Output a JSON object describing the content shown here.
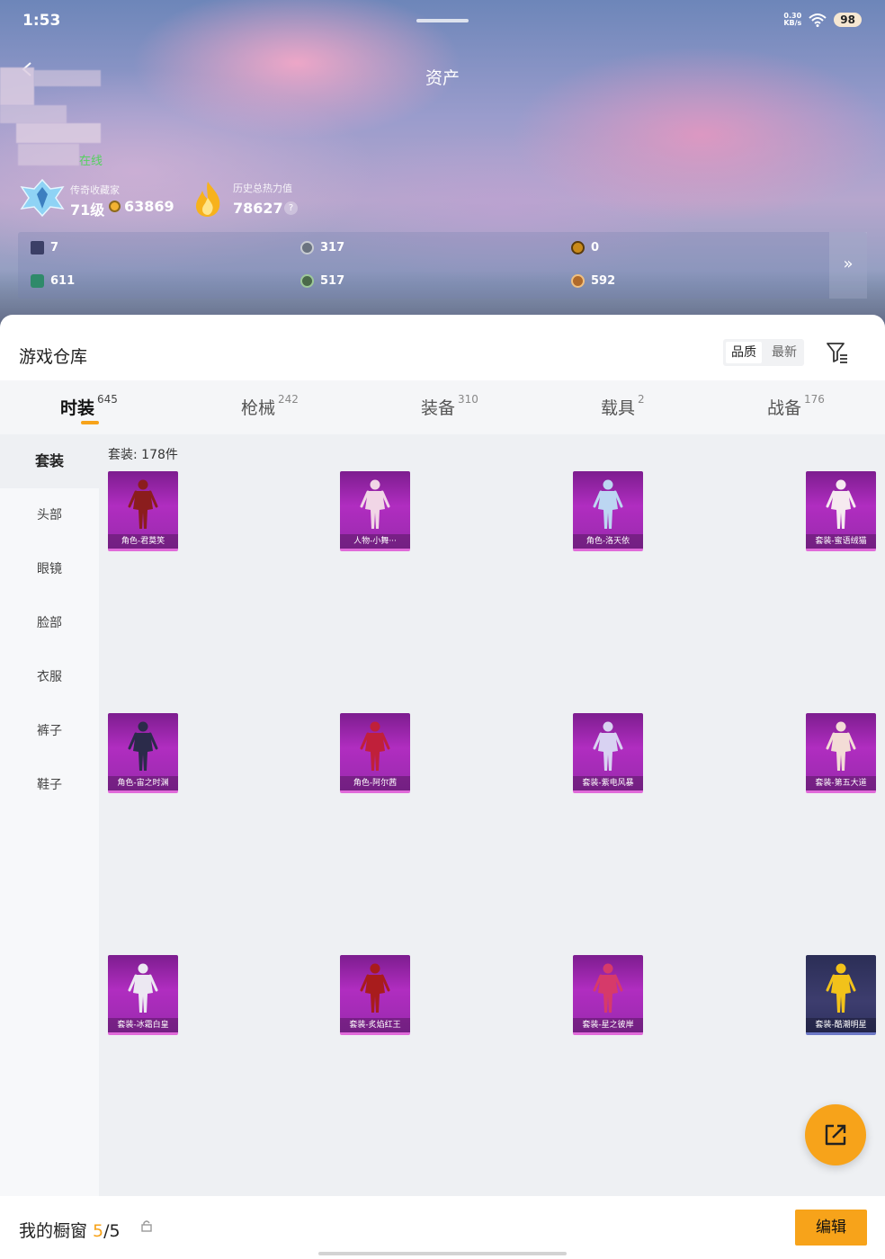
{
  "status": {
    "time": "1:53",
    "net_speed_top": "0.30",
    "net_speed_bottom": "KB/s",
    "battery": "98"
  },
  "header": {
    "title": "资产",
    "online": "在线",
    "rank_title": "传奇收藏家",
    "rank_level": "71级",
    "coins": "63869",
    "heat_title": "历史总热力值",
    "heat_value": "78627",
    "help": "?"
  },
  "stats": [
    {
      "icon": "card-icon",
      "value": "7",
      "color": "#3b3f66"
    },
    {
      "icon": "silver-coin-icon",
      "value": "317",
      "color": "#6a7380"
    },
    {
      "icon": "gold-token-icon",
      "value": "0",
      "color": "#c98a1a"
    },
    {
      "icon": "gem-icon",
      "value": "611",
      "color": "#2f8a6a"
    },
    {
      "icon": "orb-icon",
      "value": "517",
      "color": "#4a6a4a"
    },
    {
      "icon": "bronze-coin-icon",
      "value": "592",
      "color": "#b06a2a"
    }
  ],
  "stats_more": "»",
  "warehouse": {
    "title": "游戏仓库",
    "sort": [
      "品质",
      "最新"
    ],
    "tabs": [
      {
        "label": "时装",
        "count": "645"
      },
      {
        "label": "枪械",
        "count": "242"
      },
      {
        "label": "装备",
        "count": "310"
      },
      {
        "label": "载具",
        "count": "2"
      },
      {
        "label": "战备",
        "count": "176"
      }
    ],
    "side": [
      "套装",
      "头部",
      "眼镜",
      "脸部",
      "衣服",
      "裤子",
      "鞋子"
    ],
    "count_label": "套装: 178件",
    "items": [
      {
        "label": "角色-君莫笑",
        "color": "#8b1d1d"
      },
      {
        "label": "人物-小舞···",
        "color": "#f1d6e6"
      },
      {
        "label": "角色-洛天依",
        "color": "#bcd6f2"
      },
      {
        "label": "套装-蜜语绒猫",
        "color": "#f6eaf0"
      },
      {
        "label": "角色-宙之时渊",
        "color": "#2b2b4a"
      },
      {
        "label": "角色-阿尔茜",
        "color": "#c0203a"
      },
      {
        "label": "套装-紫电风暴",
        "color": "#d8d2f2"
      },
      {
        "label": "套装-第五大道",
        "color": "#f3dcd6"
      },
      {
        "label": "套装-冰霜白皇",
        "color": "#ece8f2"
      },
      {
        "label": "套装-炙焰红王",
        "color": "#a81c1c"
      },
      {
        "label": "套装-星之彼岸",
        "color": "#d63a6a"
      },
      {
        "label": "套装-酷潮明星",
        "color": "#f2c21a"
      }
    ]
  },
  "showcase": {
    "title": "我的橱窗",
    "count": "5",
    "total": "/5",
    "edit": "编辑"
  },
  "colors": {
    "accent": "#f7a31a",
    "item_bg": "#9a2aae",
    "online": "#55d15f"
  }
}
